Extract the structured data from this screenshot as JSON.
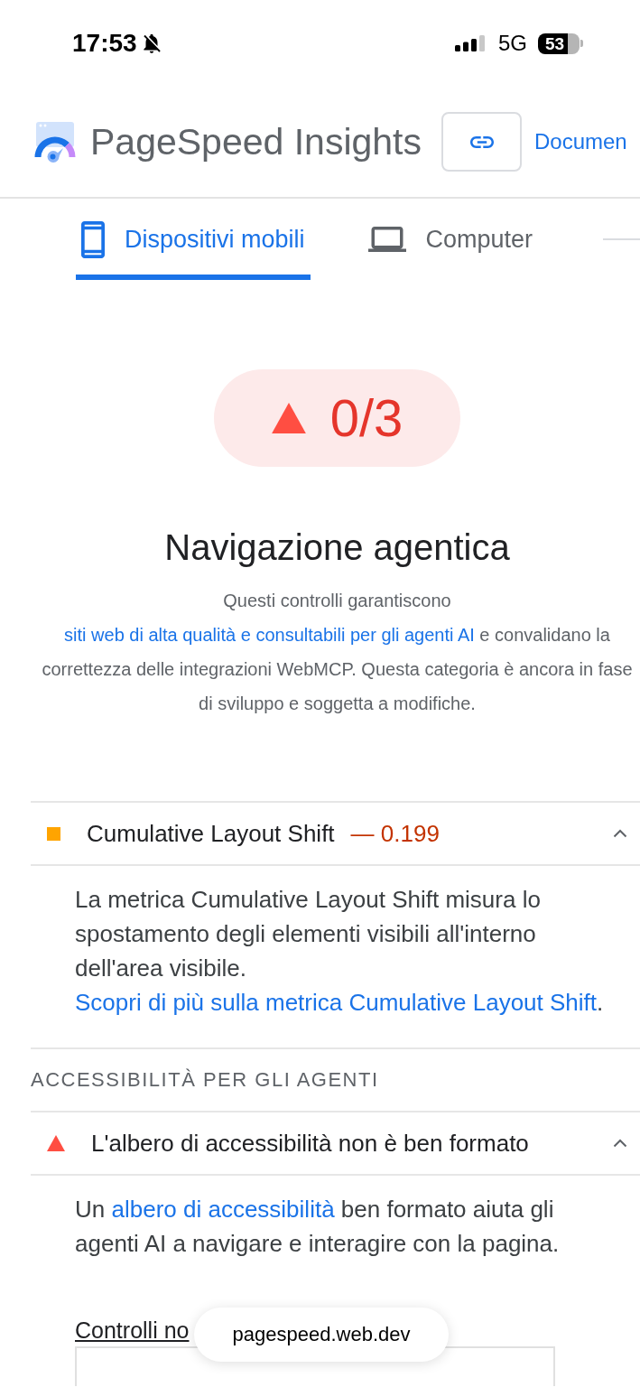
{
  "status_bar": {
    "time": "17:53",
    "silent": true,
    "network": "5G",
    "battery": "53"
  },
  "header": {
    "title": "PageSpeed Insights",
    "docs_link": "Documen"
  },
  "tabs": [
    {
      "label": "Dispositivi mobili",
      "kind": "mobile",
      "selected": true
    },
    {
      "label": "Computer",
      "kind": "desktop",
      "selected": false
    }
  ],
  "category": {
    "score": "0/3",
    "kind": "fail",
    "title": "Navigazione agentica",
    "description": [
      {
        "kind": "text",
        "text": "Questi controlli garantiscono "
      },
      {
        "kind": "link",
        "text": "siti web di alta qualità e consultabili per gli agenti AI"
      },
      {
        "kind": "text",
        "text": " e convalidano la correttezza delle integrazioni WebMCP. Questa categoria è ancora in fase di sviluppo e soggetta a modifiche."
      }
    ]
  },
  "audits": [
    {
      "kind": "average",
      "title": "Cumulative Layout Shift",
      "value": "— 0.199",
      "expanded": true,
      "description": [
        {
          "kind": "text",
          "text": "La metrica Cumulative Layout Shift misura lo spostamento degli elementi visibili all'interno dell'area visibile. "
        },
        {
          "kind": "link",
          "text": "Scopri di più sulla metrica Cumulative Layout Shift"
        },
        {
          "kind": "text",
          "text": "."
        }
      ]
    }
  ],
  "groups": [
    {
      "title": "ACCESSIBILITÀ PER GLI AGENTI",
      "audits": [
        {
          "kind": "fail",
          "title": "L'albero di accessibilità non è ben formato",
          "expanded": true,
          "description": [
            {
              "kind": "text",
              "text": "Un "
            },
            {
              "kind": "link",
              "text": "albero di accessibilità"
            },
            {
              "kind": "text",
              "text": " ben formato aiuta gli agenti AI a navigare e interagire con la pagina."
            }
          ],
          "details": {
            "title": "Controlli no"
          }
        }
      ]
    }
  ],
  "browser": {
    "url": "pagespeed.web.dev"
  }
}
